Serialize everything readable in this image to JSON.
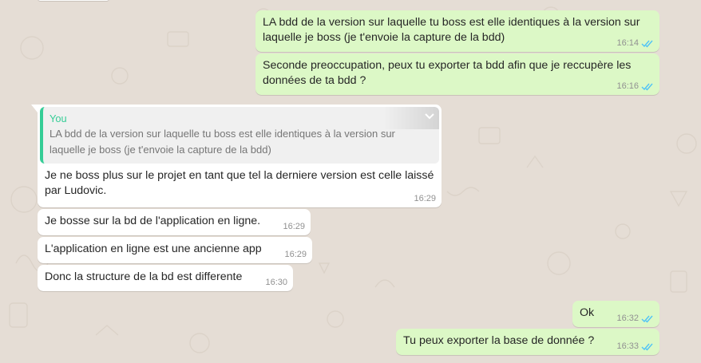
{
  "conversation": {
    "messages": [
      {
        "id": "m1",
        "direction": "out",
        "text": "LA bdd de la version sur laquelle tu boss est elle identiques à la version sur laquelle je boss (je t'envoie la capture de la bdd)",
        "time": "16:14",
        "status": "read"
      },
      {
        "id": "m2",
        "direction": "out",
        "text": "Seconde preoccupation, peux tu exporter ta bdd afin que je reccupère les données de ta bdd ?",
        "time": "16:16",
        "status": "read"
      },
      {
        "id": "m3",
        "direction": "in",
        "reply_to": {
          "author": "You",
          "text": "LA bdd de la version sur laquelle tu boss est elle identiques à la version sur laquelle je boss (je t'envoie la capture de la bdd)"
        },
        "text": "Je ne boss plus sur le projet en tant que tel la derniere version est celle laissé par Ludovic.",
        "time": "16:29"
      },
      {
        "id": "m4",
        "direction": "in",
        "text": "Je bosse sur la bd de l'application en ligne.",
        "time": "16:29"
      },
      {
        "id": "m5",
        "direction": "in",
        "text": "L'application en ligne est une ancienne app",
        "time": "16:29"
      },
      {
        "id": "m6",
        "direction": "in",
        "text": "Donc la structure de la bd est differente",
        "time": "16:30"
      },
      {
        "id": "m7",
        "direction": "out",
        "text": "Ok",
        "time": "16:32",
        "status": "read"
      },
      {
        "id": "m8",
        "direction": "out",
        "text": "Tu peux exporter la base de donnée ?",
        "time": "16:33",
        "status": "read"
      }
    ]
  },
  "colors": {
    "wallpaper": "#e5ddd5",
    "outgoing_bubble": "#dcf8c6",
    "incoming_bubble": "#ffffff",
    "read_check": "#4fc3f7",
    "quote_accent": "#35cd96",
    "timestamp": "#919191"
  },
  "icons": {
    "read_status": "double-check-icon",
    "quote_menu": "chevron-down-icon"
  }
}
